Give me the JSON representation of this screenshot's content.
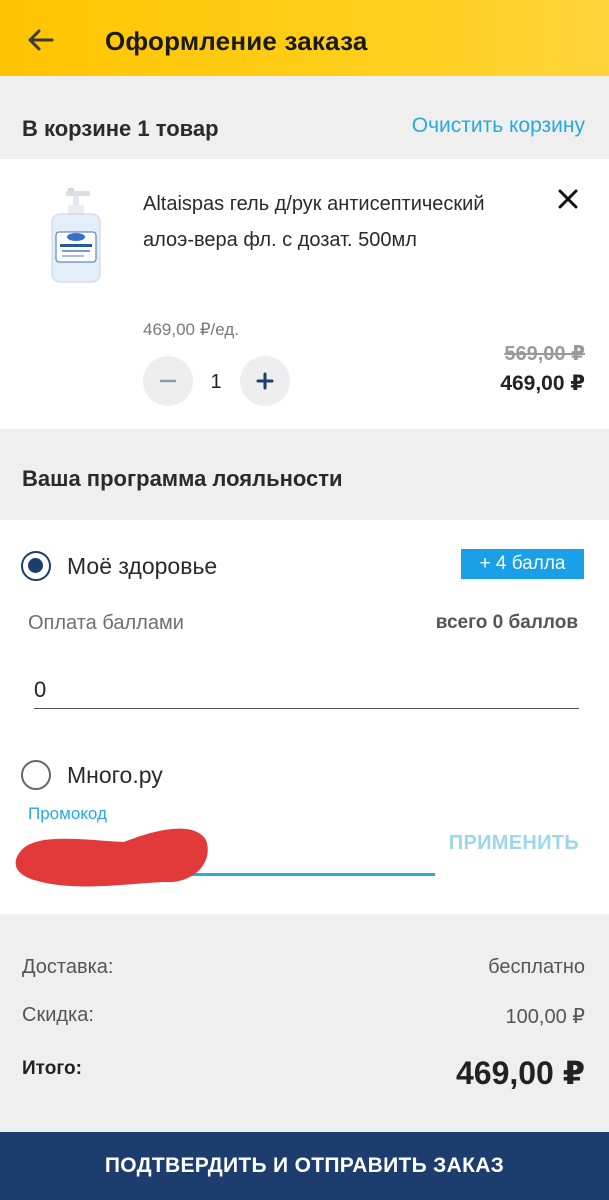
{
  "header": {
    "title": "Оформление заказа",
    "back_icon": "arrow-left-icon",
    "background": "#ffc400"
  },
  "cart": {
    "count_label": "В корзине 1 товар",
    "clear_label": "Очистить корзину",
    "accent": "#29a9e1"
  },
  "product": {
    "name": "Altaispas гель д/рук антисептический алоэ-вера фл. с дозат. 500мл",
    "unit_price": "469,00 ₽/ед.",
    "quantity": "1",
    "old_price": "569,00 ₽",
    "price": "469,00 ₽",
    "remove_icon": "close-icon",
    "minus_icon": "minus-icon",
    "plus_icon": "plus-icon"
  },
  "loyalty": {
    "title": "Ваша программа лояльности",
    "options": [
      {
        "label": "Моё здоровье",
        "selected": true
      },
      {
        "label": "Много.ру",
        "selected": false
      }
    ],
    "bonus_badge": "+ 4 балла",
    "pay_points_label": "Оплата баллами",
    "total_points": "всего 0 баллов",
    "points_value": "0",
    "promo_label": "Промокод",
    "apply_label": "ПРИМЕНИТЬ",
    "badge_color": "#1aa0e8"
  },
  "summary": {
    "delivery_label": "Доставка:",
    "delivery_value": "бесплатно",
    "discount_label": "Скидка:",
    "discount_value": "100,00 ₽",
    "total_label": "Итого:",
    "total_value": "469,00 ₽"
  },
  "submit": {
    "label": "ПОДТВЕРДИТЬ И ОТПРАВИТЬ ЗАКАЗ",
    "background": "#1d3d6e"
  }
}
